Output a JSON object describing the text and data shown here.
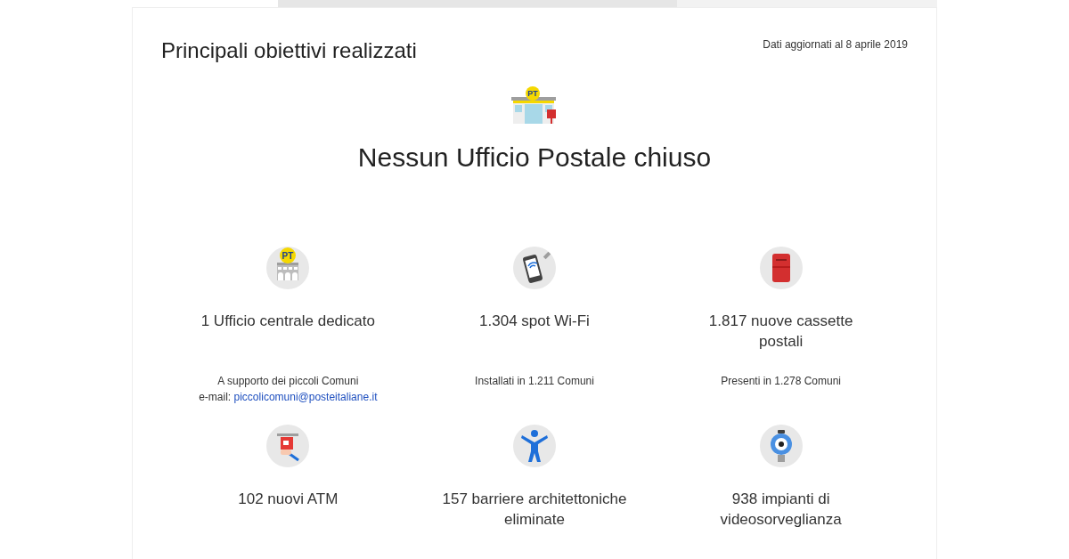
{
  "section": {
    "title": "Principali obiettivi realizzati",
    "updated": "Dati aggiornati al 8 aprile 2019"
  },
  "hero": {
    "icon_badge": "PT",
    "heading": "Nessun Ufficio Postale chiuso"
  },
  "stats": [
    {
      "kind": "office",
      "badge": "PT",
      "title": "1 Ufficio centrale dedicato",
      "lines": [
        {
          "text": "A supporto dei piccoli Comuni"
        },
        {
          "text": "e-mail: ",
          "link": "piccolicomuni@posteitaliane.it"
        }
      ]
    },
    {
      "kind": "phone",
      "title": "1.304 spot Wi-Fi",
      "lines": [
        {
          "text": "Installati in 1.211 Comuni"
        }
      ]
    },
    {
      "kind": "mailbox",
      "title": "1.817 nuove cassette postali",
      "lines": [
        {
          "text": "Presenti in 1.278 Comuni"
        }
      ]
    },
    {
      "kind": "atm",
      "title": "102 nuovi ATM"
    },
    {
      "kind": "person",
      "title": "157 barriere architettoniche eliminate"
    },
    {
      "kind": "camera",
      "title": "938 impianti di videosorveglianza"
    }
  ]
}
